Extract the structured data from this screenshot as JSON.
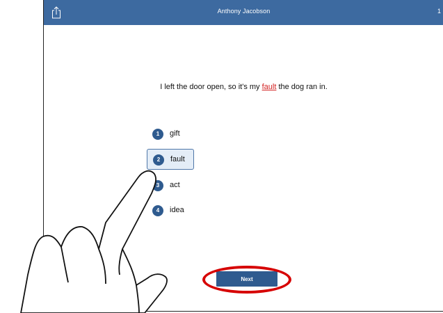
{
  "header": {
    "title": "Anthony Jacobson",
    "page_indicator": "1",
    "share_icon": "share-icon"
  },
  "question": {
    "before": "I left the door open, so it's my ",
    "target": "fault",
    "after": " the dog ran in."
  },
  "options": [
    {
      "number": "1",
      "label": "gift",
      "selected": false
    },
    {
      "number": "2",
      "label": "fault",
      "selected": true
    },
    {
      "number": "3",
      "label": "act",
      "selected": false
    },
    {
      "number": "4",
      "label": "idea",
      "selected": false
    }
  ],
  "next_button": {
    "label": "Next"
  },
  "colors": {
    "header_bg": "#3d6aa0",
    "accent": "#2f5b8f",
    "target_word": "#d21f1f",
    "annotation_ring": "#d60000"
  }
}
